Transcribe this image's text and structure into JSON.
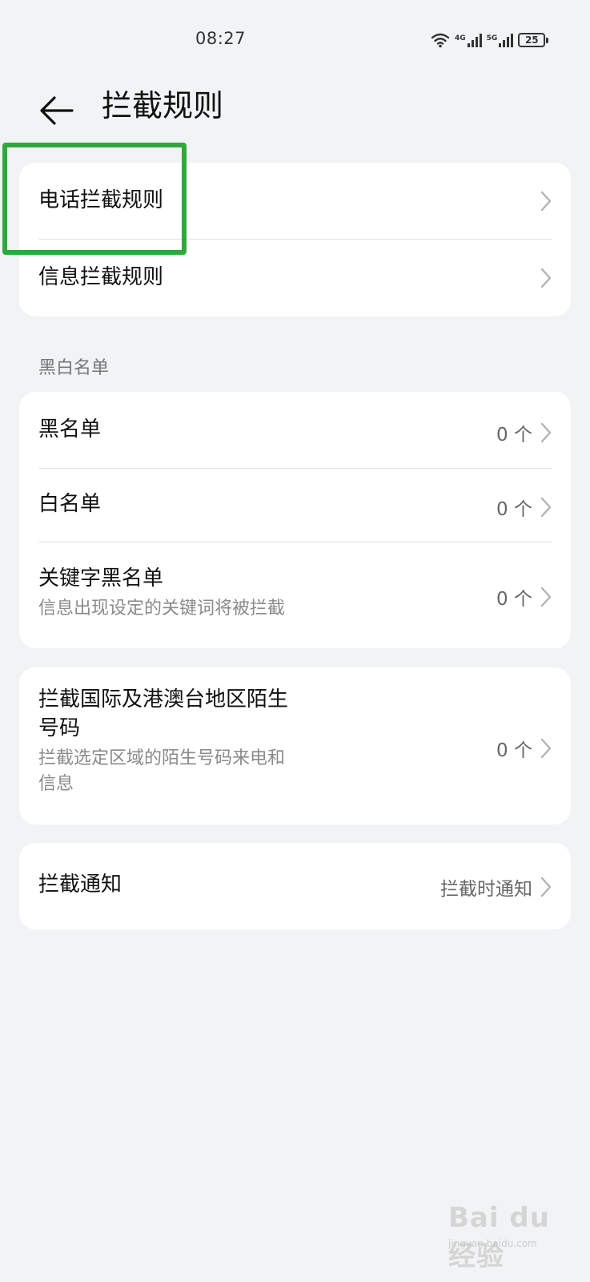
{
  "status_bar": {
    "time": "08:27",
    "network1": "4G",
    "network2": "5G",
    "battery": "25",
    "icons": [
      "wifi-icon",
      "signal-icon",
      "battery-icon"
    ]
  },
  "header": {
    "back_icon": "back-arrow-icon",
    "title": "拦截规则"
  },
  "rules_card": {
    "items": [
      {
        "label": "电话拦截规则"
      },
      {
        "label": "信息拦截规则"
      }
    ]
  },
  "blackwhite_section": {
    "label": "黑白名单",
    "items": [
      {
        "label": "黑名单",
        "value": "0 个"
      },
      {
        "label": "白名单",
        "value": "0 个"
      },
      {
        "label": "关键字黑名单",
        "sub": "信息出现设定的关键词将被拦截",
        "value": "0 个"
      }
    ]
  },
  "intl_card": {
    "title_line1": "拦截国际及港澳台地区陌生",
    "title_line2": "号码",
    "sub_line1": "拦截选定区域的陌生号码来电和",
    "sub_line2": "信息",
    "value": "0 个"
  },
  "notify_card": {
    "label": "拦截通知",
    "value": "拦截时通知"
  },
  "watermark": {
    "main": "Bai du 经验",
    "sub": "jingyan.baidu.com"
  },
  "colors": {
    "background": "#f1f3f5",
    "card": "#ffffff",
    "highlight": "#2ea93b",
    "secondary_text": "#8a8a8a"
  }
}
